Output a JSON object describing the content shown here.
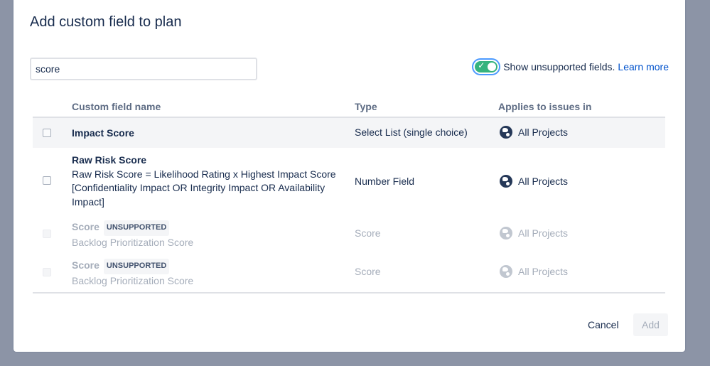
{
  "dialog": {
    "title": "Add custom field to plan",
    "search_value": "score",
    "toggle_label": "Show unsupported fields.",
    "learn_more": "Learn more",
    "toggle_on": true
  },
  "table": {
    "headers": {
      "name": "Custom field name",
      "type": "Type",
      "applies": "Applies to issues in"
    },
    "rows": [
      {
        "name": "Impact Score",
        "description": "",
        "type": "Select List (single choice)",
        "applies": "All Projects",
        "supported": true
      },
      {
        "name": "Raw Risk Score",
        "description_lines": [
          "Raw Risk Score = Likelihood Rating x Highest Impact Score",
          "[Confidentiality Impact OR Integrity Impact OR Availability",
          "Impact]"
        ],
        "type": "Number Field",
        "applies": "All Projects",
        "supported": true
      },
      {
        "name": "Score",
        "badge": "UNSUPPORTED",
        "description": "Backlog Prioritization Score",
        "type": "Score",
        "applies": "All Projects",
        "supported": false
      },
      {
        "name": "Score",
        "badge": "UNSUPPORTED",
        "description": "Backlog Prioritization Score",
        "type": "Score",
        "applies": "All Projects",
        "supported": false
      }
    ]
  },
  "footer": {
    "cancel": "Cancel",
    "add": "Add"
  },
  "icons": {
    "applies_icon": "globe-icon",
    "toggle_check": "check-icon"
  },
  "colors": {
    "toggle_on": "#36b37e",
    "link": "#0052cc",
    "overlay": "#8c94a6"
  }
}
